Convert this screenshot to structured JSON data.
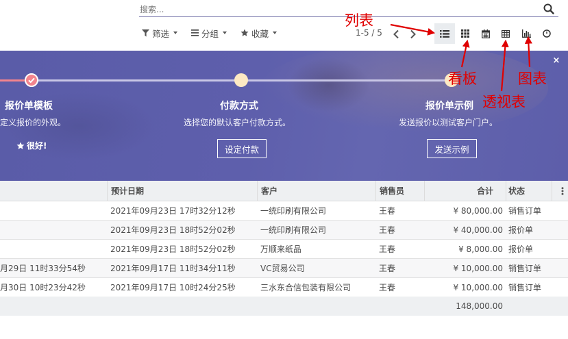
{
  "search": {
    "placeholder": "搜索..."
  },
  "filters": {
    "filter_label": "筛选",
    "group_label": "分组",
    "favorites_label": "收藏"
  },
  "pager": {
    "text": "1-5 / 5"
  },
  "banner": {
    "steps": [
      {
        "title": "报价单模板",
        "desc": "定义报价的外观。",
        "status_text": "很好!"
      },
      {
        "title": "付款方式",
        "desc": "选择您的默认客户付款方式。",
        "button": "设定付款"
      },
      {
        "title": "报价单示例",
        "desc": "发送报价以测试客户门户。",
        "button": "发送示例"
      }
    ],
    "close_glyph": "×"
  },
  "table": {
    "columns": [
      "预计日期",
      "客户",
      "销售员",
      "合计",
      "状态"
    ],
    "rows": [
      {
        "create_date": "",
        "expected_date": "2021年09月23日 17时32分12秒",
        "customer": "一统印刷有限公司",
        "salesperson": "王春",
        "total": "¥ 80,000.00",
        "status": "销售订单"
      },
      {
        "create_date": "",
        "expected_date": "2021年09月23日 18时52分02秒",
        "customer": "一统印刷有限公司",
        "salesperson": "王春",
        "total": "¥ 40,000.00",
        "status": "报价单"
      },
      {
        "create_date": "",
        "expected_date": "2021年09月23日 18时52分02秒",
        "customer": "万顺来纸品",
        "salesperson": "王春",
        "total": "¥ 8,000.00",
        "status": "报价单"
      },
      {
        "create_date": "月29日 11时33分54秒",
        "expected_date": "2021年09月17日 11时34分11秒",
        "customer": "VC贸易公司",
        "salesperson": "王春",
        "total": "¥ 10,000.00",
        "status": "销售订单"
      },
      {
        "create_date": "月30日 10时23分42秒",
        "expected_date": "2021年09月17日 10时24分25秒",
        "customer": "三水东合信包装有限公司",
        "salesperson": "王春",
        "total": "¥ 10,000.00",
        "status": "销售订单"
      }
    ],
    "footer_total": "148,000.00"
  },
  "annotations": {
    "list": "列表",
    "kanban": "看板",
    "pivot": "透视表",
    "graph": "图表"
  },
  "colors": {
    "annotation": "#e00000",
    "banner": "#5a5ca8",
    "progress_done": "#f3848d",
    "step_todo": "#fde9c3"
  }
}
